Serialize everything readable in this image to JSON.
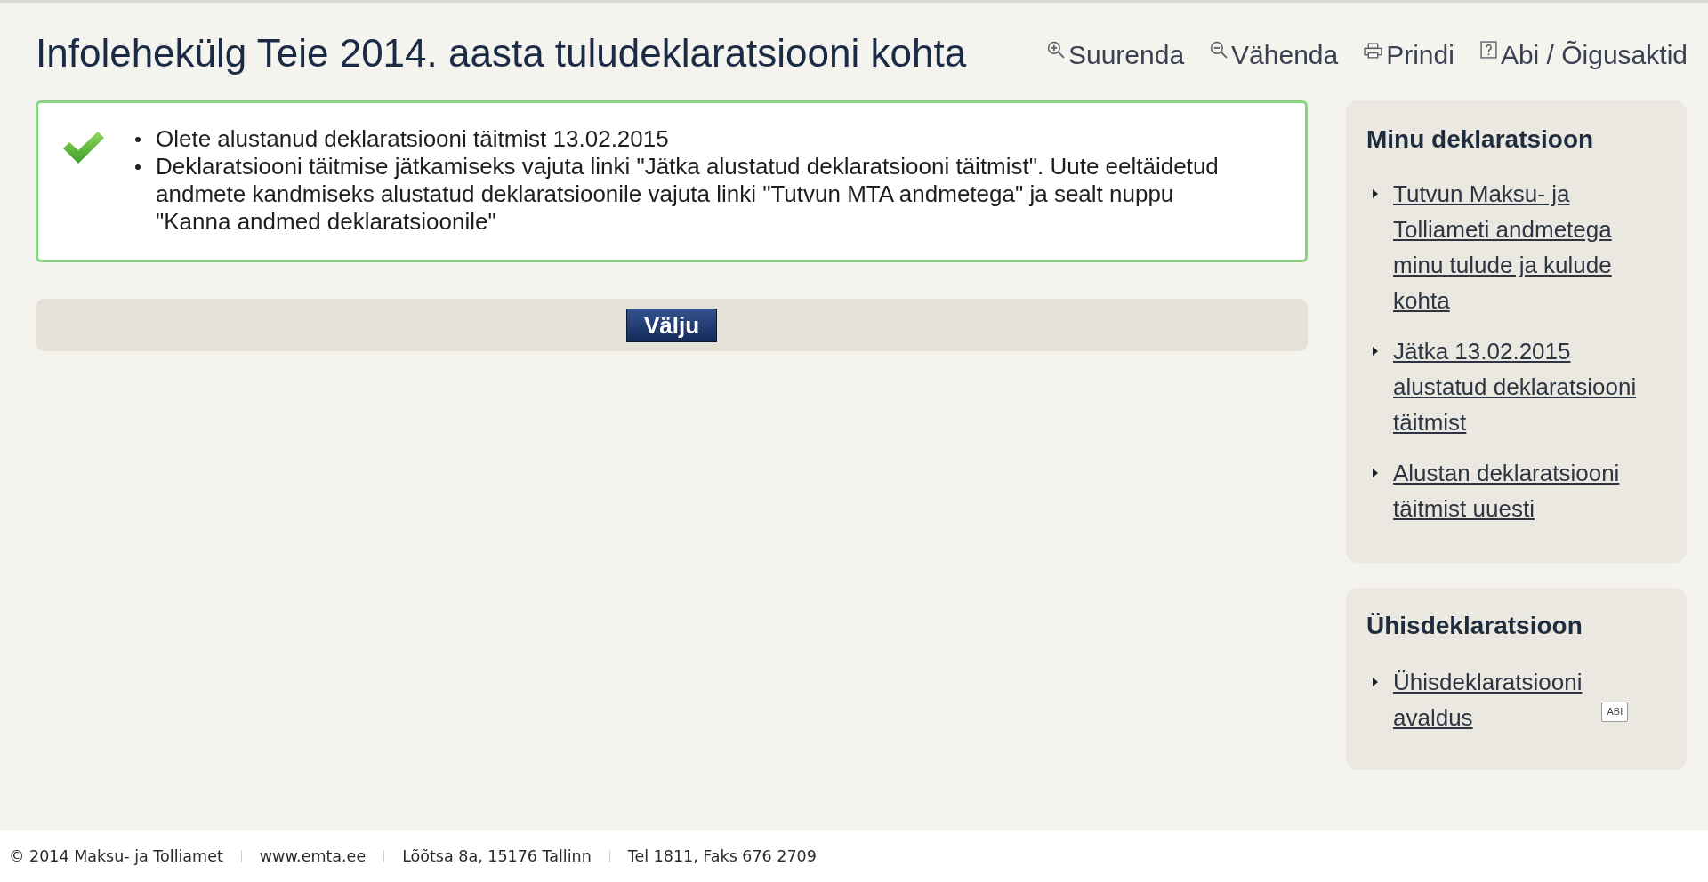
{
  "header": {
    "title": "Infolehekülg Teie 2014. aasta tuludeklaratsiooni kohta",
    "tools": [
      {
        "kind": "zoom_in",
        "label": "Suurenda"
      },
      {
        "kind": "zoom_out",
        "label": "Vähenda"
      },
      {
        "kind": "print",
        "label": "Prindi"
      },
      {
        "kind": "help",
        "label": "Abi / Õigusaktid"
      }
    ]
  },
  "message": {
    "kind": "success",
    "items": [
      "Olete alustanud deklaratsiooni täitmist 13.02.2015",
      "Deklaratsiooni täitmise jätkamiseks vajuta linki \"Jätka alustatud deklaratsiooni täitmist\". Uute eeltäidetud andmete kandmiseks alustatud deklaratsioonile vajuta linki \"Tutvun MTA andmetega\" ja sealt nuppu \"Kanna andmed deklaratsioonile\""
    ]
  },
  "actions": {
    "buttons": [
      "Välju"
    ]
  },
  "sidebar": {
    "panels": [
      {
        "title": "Minu deklaratsioon",
        "links": [
          {
            "label": "Tutvun Maksu- ja Tolliameti andmetega minu tulude ja kulude kohta"
          },
          {
            "label": "Jätka 13.02.2015 alustatud deklaratsiooni täitmist"
          },
          {
            "label": "Alustan deklaratsiooni täitmist uuesti"
          }
        ]
      },
      {
        "title": "Ühisdeklaratsioon",
        "links": [
          {
            "label": "Ühisdeklaratsiooni avaldus",
            "badge": "ABI"
          }
        ]
      }
    ]
  },
  "footer": {
    "items": [
      "© 2014 Maksu- ja Tolliamet",
      "www.emta.ee",
      "Lõõtsa 8a, 15176 Tallinn",
      "Tel 1811, Faks 676 2709"
    ]
  }
}
